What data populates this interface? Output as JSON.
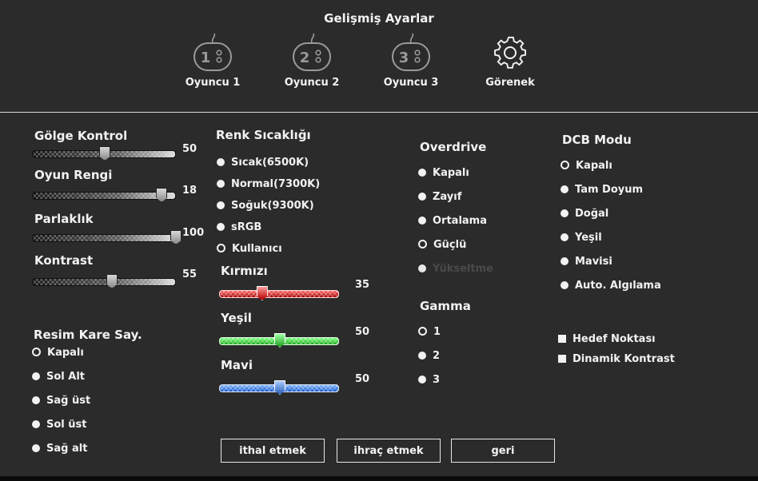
{
  "header": {
    "title": "Gelişmiş Ayarlar",
    "profiles": [
      {
        "label": "Oyuncu 1",
        "number": "1"
      },
      {
        "label": "Oyuncu 2",
        "number": "2"
      },
      {
        "label": "Oyuncu 3",
        "number": "3"
      },
      {
        "label": "Görenek"
      }
    ]
  },
  "sliders": {
    "shadow": {
      "label": "Gölge Kontrol",
      "value": "50",
      "fraction": 0.5
    },
    "game_color": {
      "label": "Oyun Rengi",
      "value": "18",
      "fraction": 0.9
    },
    "brightness": {
      "label": "Parlaklık",
      "value": "100",
      "fraction": 1.0
    },
    "contrast": {
      "label": "Kontrast",
      "value": "55",
      "fraction": 0.55
    }
  },
  "frame_counter": {
    "title": "Resim Kare Say.",
    "options": [
      "Kapalı",
      "Sol Alt",
      "Sağ üst",
      "Sol üst",
      "Sağ alt"
    ],
    "selected": "Kapalı"
  },
  "color_temp": {
    "title": "Renk Sıcaklığı",
    "options": [
      "Sıcak(6500K)",
      "Normal(7300K)",
      "Soğuk(9300K)",
      "sRGB",
      "Kullanıcı"
    ],
    "selected": "Kullanıcı"
  },
  "rgb": {
    "red": {
      "label": "Kırmızı",
      "value": "35",
      "fraction": 0.35,
      "color": "#c81414"
    },
    "green": {
      "label": "Yeşil",
      "value": "50",
      "fraction": 0.5,
      "color": "#22b422"
    },
    "blue": {
      "label": "Mavi",
      "value": "50",
      "fraction": 0.5,
      "color": "#2a6fd6"
    }
  },
  "overdrive": {
    "title": "Overdrive",
    "options": [
      "Kapalı",
      "Zayıf",
      "Ortalama",
      "Güçlü",
      "Yükseltme"
    ],
    "selected": "Güçlü",
    "disabled": [
      "Yükseltme"
    ]
  },
  "gamma": {
    "title": "Gamma",
    "options": [
      "1",
      "2",
      "3"
    ],
    "selected": "1"
  },
  "dcb": {
    "title": "DCB Modu",
    "options": [
      "Kapalı",
      "Tam Doyum",
      "Doğal",
      "Yeşil",
      "Mavisi",
      "Auto. Algılama"
    ],
    "selected": "Kapalı"
  },
  "checks": {
    "target": "Hedef Noktası",
    "dynamic_contrast": "Dinamik Kontrast"
  },
  "buttons": {
    "import": "ithal etmek",
    "export": "ihraç etmek",
    "back": "geri"
  }
}
